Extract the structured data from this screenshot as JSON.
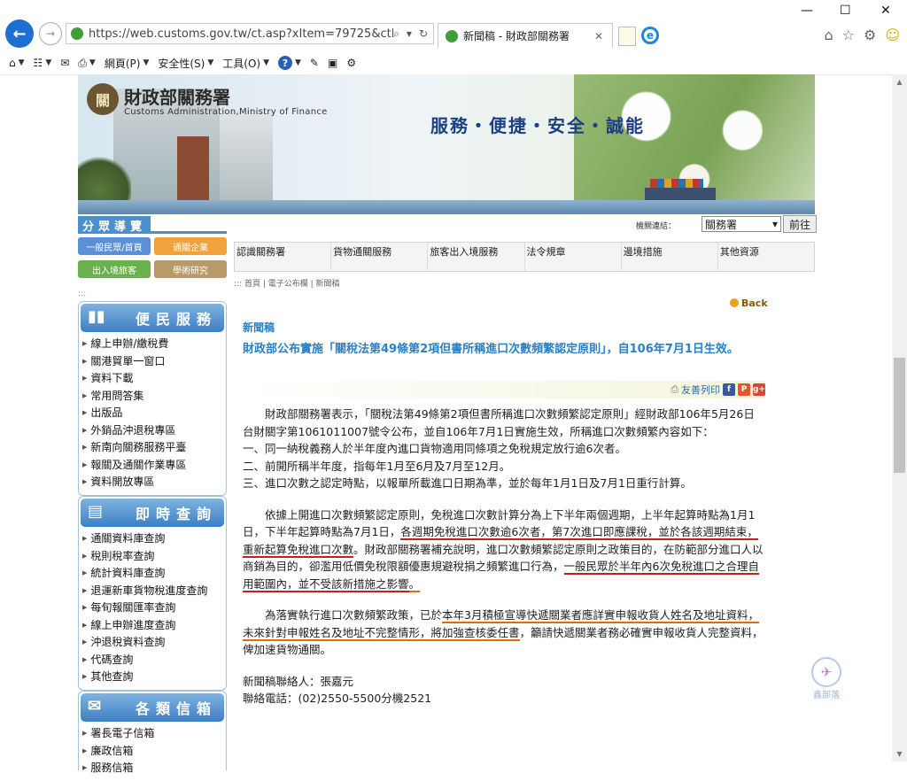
{
  "browser": {
    "url": "https://web.customs.gov.tw/ct.asp?xItem=79725&ctNode=4",
    "tab_title": "新聞稿 - 財政部關務署",
    "menu": {
      "page": "網頁(P)",
      "safety": "安全性(S)",
      "tools": "工具(O)"
    }
  },
  "header": {
    "org_name": "財政部關務署",
    "org_name_en": "Customs Administration,Ministry of Finance",
    "slogan": "服務・便捷・安全・誠能",
    "seal_char": "關"
  },
  "site_link": {
    "label": "機關連結：",
    "selected": "關務署",
    "go": "前往"
  },
  "division_nav": {
    "title": "分眾導覽",
    "buttons": [
      "一般民眾/首頁",
      "通關企業",
      "出入境旅客",
      "學術研究"
    ]
  },
  "top_menu": [
    "認識關務署",
    "貨物通關服務",
    "旅客出入境服務",
    "法令規章",
    "邊境措施",
    "其他資源"
  ],
  "breadcrumb": "::: 首頁 | 電子公布欄 | 新聞稿",
  "sidebar": {
    "box1": {
      "title": "便民服務",
      "items": [
        "線上申辦/繳稅費",
        "關港貿單一窗口",
        "資料下載",
        "常用問答集",
        "出版品",
        "外銷品沖退稅專區",
        "新南向關務服務平臺",
        "報關及通關作業專區",
        "資料開放專區"
      ]
    },
    "box2": {
      "title": "即時查詢",
      "items": [
        "通關資料庫查詢",
        "稅則稅率查詢",
        "統計資料庫查詢",
        "退運新車貨物稅進度查詢",
        "每旬報關匯率查詢",
        "線上申辦進度查詢",
        "沖退稅資料查詢",
        "代碼查詢",
        "其他查詢"
      ]
    },
    "box3": {
      "title": "各類信箱",
      "items": [
        "署長電子信箱",
        "廉政信箱",
        "服務信箱"
      ]
    }
  },
  "article": {
    "back": "Back",
    "section": "新聞稿",
    "title": "財政部公布實施「關稅法第49條第2項但書所稱進口次數頻繁認定原則」，自106年7月1日生效。",
    "print": "友善列印",
    "p1": "財政部關務署表示，「關稅法第49條第2項但書所稱進口次數頻繁認定原則」經財政部106年5月26日台財關字第1061011007號令公布，並自106年7月1日實施生效，所稱進口次數頻繁內容如下：",
    "item1": "一、同一納稅義務人於半年度內進口貨物適用同條項之免稅規定放行逾6次者。",
    "item2": "二、前開所稱半年度，指每年1月至6月及7月至12月。",
    "item3": "三、進口次數之認定時點，以報單所載進口日期為準，並於每年1月1日及7月1日重行計算。",
    "p2": {
      "s1": "依據上開進口次數頻繁認定原則，免稅進口次數計算分為上下半年兩個週期，上半年起算時點為1月1日，下半年起算時點為7月1日，",
      "u1": "各週期免稅進口次數逾6次者，第7次進口即應課稅，並於各該週期結束，重新起算免稅進口次數",
      "s2": "。財政部關務署補充說明，進口次數頻繁認定原則之政策目的，在防範部分進口人以商銷為目的，卻濫用低價免稅限額優惠規避稅捐之頻繁進口行為，",
      "u2": "一般民眾於半年內6次免稅進口之合理自用範圍內，並不受該新措施之影響",
      "s3": "。"
    },
    "p3": {
      "s1": "為落實執行進口次數頻繁政策，已於",
      "u1": "本年3月積極宣導快遞關業者應詳實申報收貨人姓名及地址資料，未來針對申報姓名及地址不完整情形，將加強查核委任書",
      "s2": "，籲請快遞關業者務必確實申報收貨人完整資料，俾加速貨物通關。"
    },
    "contact": "新聞稿聯絡人：張嘉元",
    "phone": "聯絡電話：(02)2550-5500分機2521"
  },
  "watermark": "鑫部落"
}
